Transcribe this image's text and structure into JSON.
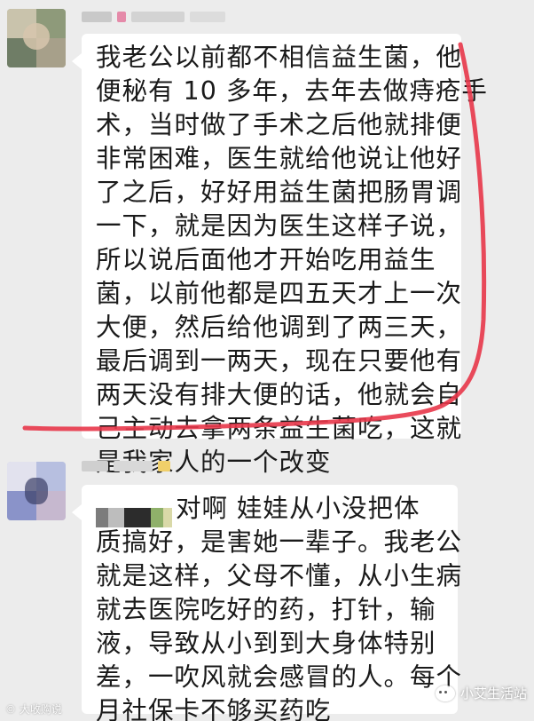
{
  "messages": [
    {
      "lines": [
        "我老公以前都不相信益生菌，他",
        "便秘有 10 多年，去年去做痔疮手",
        "术，当时做了手术之后他就排便",
        "非常困难，医生就给他说让他好",
        "了之后，好好用益生菌把肠胃调",
        "一下，就是因为医生这样子说，",
        "所以说后面他才开始吃用益生",
        "菌，以前他都是四五天才上一次",
        "大便，然后给他调到了两三天，",
        "最后调到一两天，现在只要他有",
        "两天没有排大便的话，他就会自",
        "己主动去拿两条益生菌吃，这就",
        "是我家人的一个改变"
      ]
    },
    {
      "lines": [
        "对啊 娃娃从小没把体",
        "质搞好，是害她一辈子。我老公",
        "就是这样，父母不懂，从小生病",
        "就去医院吃好的药，打针，输",
        "液，导致从小到到大身体特别",
        "差，一吹风就会感冒的人。每个",
        "月社保卡不够买药吃"
      ]
    }
  ],
  "watermarks": {
    "left": "© 大收购说",
    "right": "小艾生活站"
  },
  "colors": {
    "background": "#ececec",
    "bubble": "#ffffff",
    "annotation": "#e8374a"
  }
}
